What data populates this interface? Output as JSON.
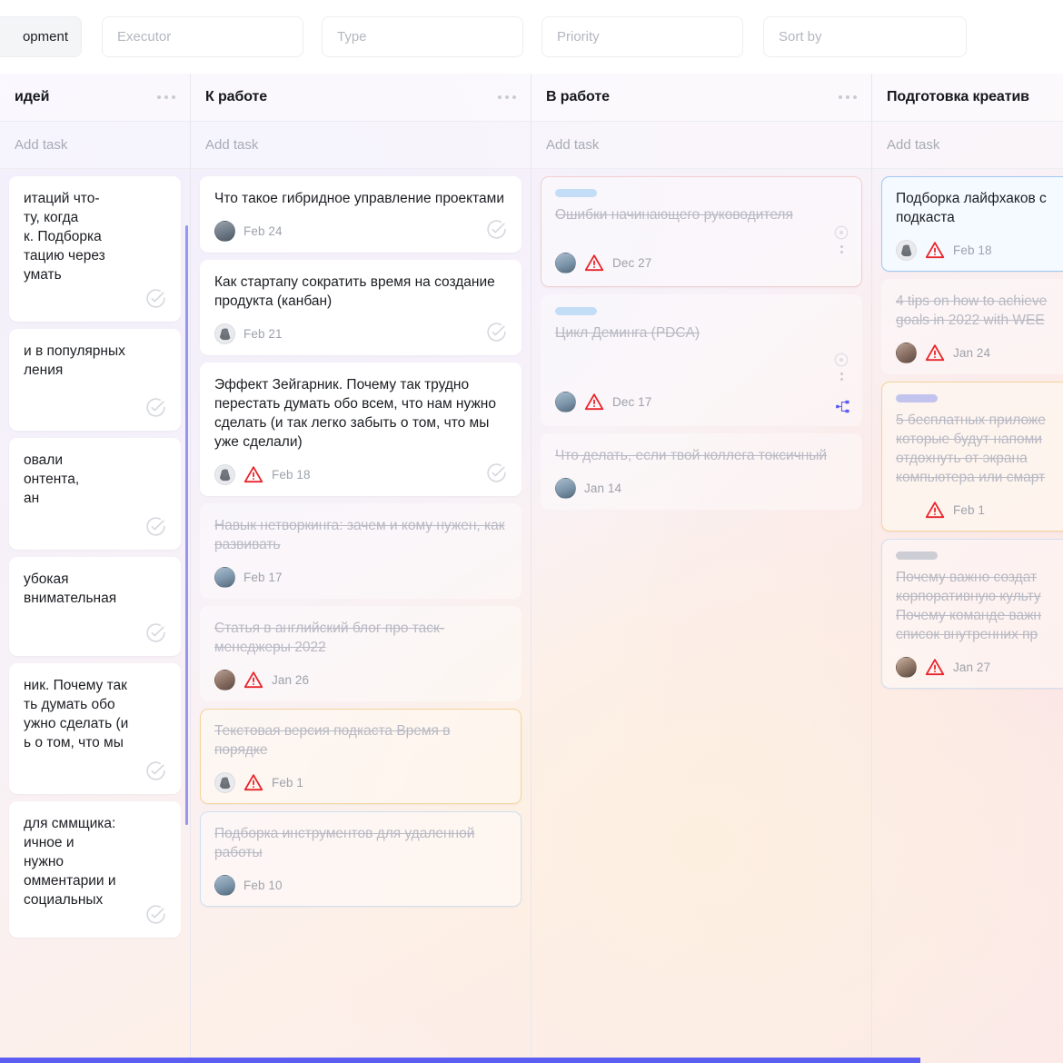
{
  "filters": {
    "project_chip": "opment",
    "executor_placeholder": "Executor",
    "type_placeholder": "Type",
    "priority_placeholder": "Priority",
    "sortby_placeholder": "Sort by"
  },
  "board": {
    "add_task_label": "Add task",
    "columns": [
      {
        "title": "идей",
        "clipped_left": true,
        "cards": [
          {
            "title": "итаций что-\nту, когда\nк. Подборка\nтацию через\nумать",
            "state": "active",
            "border": "plain",
            "tag": null,
            "avatar": null,
            "warning": false,
            "date": null,
            "check": true
          },
          {
            "title": "и в популярных\nления",
            "state": "active",
            "border": "plain",
            "tag": null,
            "avatar": null,
            "warning": false,
            "date": null,
            "check": true
          },
          {
            "title": "овали\nонтента,\nан",
            "state": "active",
            "border": "plain",
            "tag": null,
            "avatar": null,
            "warning": false,
            "date": null,
            "check": true
          },
          {
            "title": "убокая\nвнимательная",
            "state": "active",
            "border": "plain",
            "tag": null,
            "avatar": null,
            "warning": false,
            "date": null,
            "check": true
          },
          {
            "title": "ник. Почему так\nть думать обо\nужно сделать (и\nь о том, что мы",
            "state": "active",
            "border": "plain",
            "tag": null,
            "avatar": null,
            "warning": false,
            "date": null,
            "check": true
          },
          {
            "title": "для сммщика:\nичное и\nнужно\nомментарии и\nсоциальных",
            "state": "active",
            "border": "plain",
            "tag": null,
            "avatar": null,
            "warning": false,
            "date": null,
            "check": true
          }
        ]
      },
      {
        "title": "К работе",
        "clipped_left": false,
        "cards": [
          {
            "title": "Что такое гибридное управление проектами",
            "state": "active",
            "border": "plain",
            "tag": null,
            "avatar": "gray",
            "warning": false,
            "date": "Feb 24",
            "check": true
          },
          {
            "title": "Как стартапу сократить время на создание продукта (канбан)",
            "state": "active",
            "border": "plain",
            "tag": null,
            "avatar": "user",
            "warning": false,
            "date": "Feb 21",
            "check": true
          },
          {
            "title": "Эффект Зейгарник. Почему так трудно перестать думать обо всем, что нам нужно сделать (и так легко забыть о том, что мы уже сделали)",
            "state": "active",
            "border": "plain",
            "tag": null,
            "avatar": "user",
            "warning": true,
            "date": "Feb 18",
            "check": true
          },
          {
            "title": "Навык нетворкинга: зачем и кому нужен, как развивать",
            "state": "done",
            "border": "plain",
            "tag": null,
            "avatar": "sky",
            "warning": false,
            "date": "Feb 17",
            "check": false
          },
          {
            "title": "Статья в английский блог про таск-менеджеры 2022",
            "state": "done",
            "border": "plain",
            "tag": null,
            "avatar": "brown",
            "warning": true,
            "date": "Jan 26",
            "check": false
          },
          {
            "title": "Текстовая версия подкаста Время в порядке",
            "state": "done",
            "border": "orange",
            "tag": null,
            "avatar": "user",
            "warning": true,
            "date": "Feb 1",
            "check": false
          },
          {
            "title": "Подборка инструментов для удаленной работы",
            "state": "done",
            "border": "blue-soft",
            "tag": null,
            "avatar": "sky",
            "warning": false,
            "date": "Feb 10",
            "check": false
          }
        ]
      },
      {
        "title": "В работе",
        "clipped_left": false,
        "cards": [
          {
            "title": "Ошибки начинающего руководителя",
            "state": "done",
            "border": "pink",
            "tag": "blue",
            "avatar": "sky",
            "warning": true,
            "date": "Dec 27",
            "check": false,
            "target_icon": true,
            "subtask_icon": false
          },
          {
            "title": "Цикл Деминга (PDCA)",
            "state": "done",
            "border": "plain",
            "tag": "blue",
            "avatar": "sky",
            "warning": true,
            "date": "Dec 17",
            "check": false,
            "target_icon": true,
            "subtask_icon": true
          },
          {
            "title": "Что делать, если твой коллега токсичный",
            "state": "done",
            "border": "plain",
            "tag": null,
            "avatar": "sky",
            "warning": false,
            "date": "Jan 14",
            "check": false,
            "target_icon": false,
            "subtask_icon": false
          }
        ]
      },
      {
        "title": "Подготовка креатив",
        "clipped_right": true,
        "cards": [
          {
            "title": "Подборка лайфхаков с подкаста",
            "state": "active",
            "border": "blue",
            "tag": null,
            "avatar": "user",
            "warning": true,
            "date": "Feb 18",
            "check": false
          },
          {
            "title": "4 tips on how to achieve goals in 2022 with WEE",
            "state": "done",
            "border": "plain",
            "tag": null,
            "avatar": "brown",
            "warning": true,
            "date": "Jan 24",
            "check": false
          },
          {
            "title": "5 бесплатных приложе которые будут напоми отдохнуть от экрана компьютера или смарт",
            "state": "done",
            "border": "orange",
            "tag": "purple",
            "avatar": null,
            "warning": true,
            "date": "Feb 1",
            "check": false
          },
          {
            "title": "Почему важно создат корпоративную культу Почему команде важн список внутренних пр",
            "state": "done",
            "border": "blue-soft",
            "tag": "grey",
            "avatar": "face",
            "warning": true,
            "date": "Jan 27",
            "check": false
          }
        ]
      }
    ]
  },
  "colors": {
    "accent": "#5b5ef0",
    "warning_red": "#e8252b",
    "tag_blue": "#c3ddf6",
    "tag_purple": "#c3c4ee"
  }
}
